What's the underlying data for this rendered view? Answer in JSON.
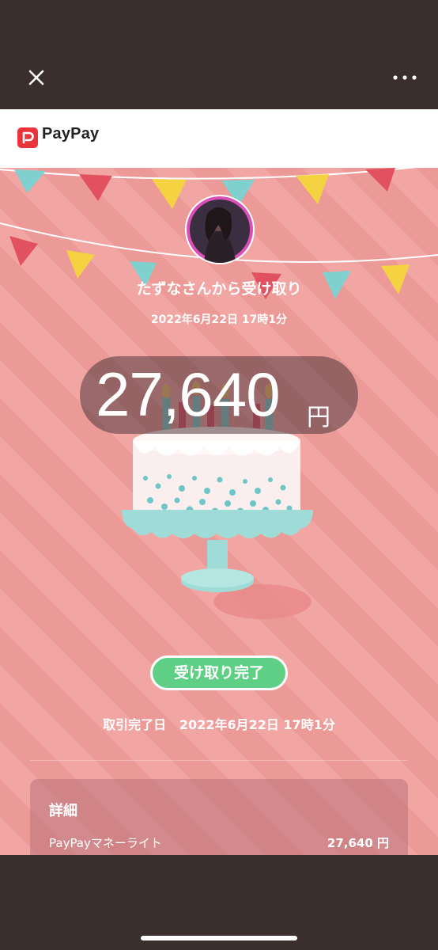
{
  "header": {
    "close_icon": "close-icon",
    "more_icon": "more-dots-icon"
  },
  "app": {
    "brand": "PayPay"
  },
  "receipt": {
    "sender_text": "たずなさんから受け取り",
    "received_datetime": "2022年6月22日 17時1分",
    "amount": "27,640",
    "currency": "円",
    "status_label": "受け取り完了",
    "completion_label": "取引完了日",
    "completion_datetime": "2022年6月22日 17時1分"
  },
  "details": {
    "title": "詳細",
    "rows": [
      {
        "label": "PayPayマネーライト",
        "value": "27,640 円"
      }
    ]
  },
  "colors": {
    "background_stripe_a": "#f2a6a4",
    "background_stripe_b": "#ec9a98",
    "status_green": "#5fcf85",
    "brand_red": "#e8343a"
  }
}
